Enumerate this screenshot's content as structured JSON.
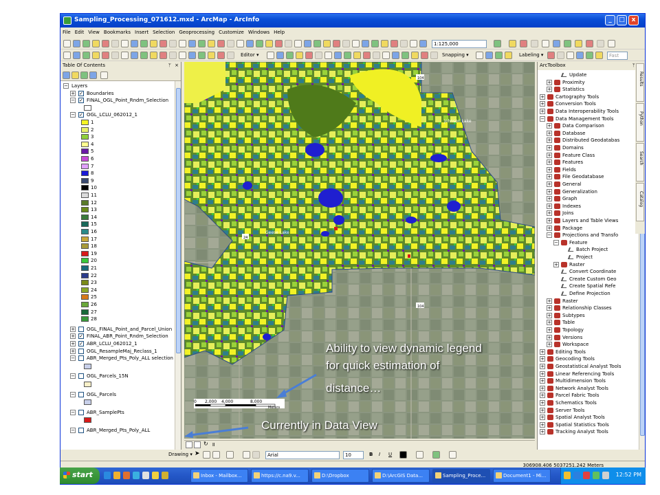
{
  "window": {
    "title": "Sampling_Processing_071612.mxd - ArcMap - ArcInfo",
    "minimize": "_",
    "maximize": "□",
    "close": "x"
  },
  "menu": [
    "File",
    "Edit",
    "View",
    "Bookmarks",
    "Insert",
    "Selection",
    "Geoprocessing",
    "Customize",
    "Windows",
    "Help"
  ],
  "toolbar": {
    "scale": "1:125,000",
    "editor": "Editor ▾",
    "snapping": "Snapping ▾",
    "labeling": "Labeling ▾",
    "fast": "Fast"
  },
  "toc": {
    "title": "Table Of Contents",
    "root": "Layers",
    "layers": [
      {
        "name": "Boundaries",
        "checked": true,
        "expanded": false,
        "indent": 1
      },
      {
        "name": "FINAL_OGL_Point_Rndm_Selection",
        "checked": true,
        "expanded": true,
        "indent": 1
      },
      {
        "name": "OGL_LCLU_062012_1",
        "checked": true,
        "expanded": true,
        "indent": 1
      }
    ],
    "legend_values": [
      "1",
      "2",
      "3",
      "4",
      "5",
      "6",
      "7",
      "8",
      "9",
      "10",
      "11",
      "12",
      "13",
      "14",
      "15",
      "16",
      "17",
      "18",
      "19",
      "20",
      "21",
      "22",
      "23",
      "24",
      "25",
      "26",
      "27",
      "28"
    ],
    "legend_colors": [
      "#f5f524",
      "#e8f06a",
      "#8fd03a",
      "#ffff90",
      "#6a1aa6",
      "#c84ad8",
      "#e0a0ff",
      "#1a1ad8",
      "#3a4a70",
      "#000000",
      "#dcdcdc",
      "#5a7a2a",
      "#6a8a1a",
      "#3a7a3a",
      "#1a6a5a",
      "#2a8a8a",
      "#c8a83a",
      "#a89a3a",
      "#d81a1a",
      "#3ac83a",
      "#1a6a7a",
      "#2a3a8a",
      "#7a8a1a",
      "#8aa82a",
      "#d87a1a",
      "#6aa83a",
      "#1a6a3a",
      "#3a9a3a"
    ],
    "layers_after": [
      {
        "name": "OGL_FINAL_Point_and_Parcel_Union",
        "checked": false,
        "expanded": false
      },
      {
        "name": "FINAL_ABR_Point_Rndm_Selection",
        "checked": true,
        "expanded": false
      },
      {
        "name": "ABR_LCLU_062012_1",
        "checked": true,
        "expanded": false
      },
      {
        "name": "OGL_ResampleMaj_Reclass_1",
        "checked": false,
        "expanded": false
      },
      {
        "name": "ABR_Merged_Pts_Poly_ALL selection",
        "checked": false,
        "expanded": true,
        "swatch": "#c8d0ea"
      },
      {
        "name": "OGL_Parcels_15N",
        "checked": false,
        "expanded": true,
        "swatch": "#f8f0c8"
      },
      {
        "name": "OGL_Parcels",
        "checked": false,
        "expanded": true,
        "swatch": "#c8d0ea"
      },
      {
        "name": "ABR_SamplePts",
        "checked": false,
        "expanded": true,
        "swatch": "#d81a1a"
      },
      {
        "name": "ABR_Merged_Pts_Poly_ALL",
        "checked": false,
        "expanded": true
      }
    ]
  },
  "map": {
    "scalebar_ticks": [
      "0",
      "2,000",
      "4,000",
      "8,000"
    ],
    "scalebar_unit": "Meters",
    "lake_labels": [
      "Johnson Lake",
      "Geese Lake"
    ],
    "road_labels": [
      "104",
      "24",
      "104"
    ]
  },
  "arctoolbox": {
    "title": "ArcToolbox",
    "items": [
      {
        "label": "Update",
        "level": 3,
        "type": "tool"
      },
      {
        "label": "Proximity",
        "level": 2,
        "type": "box"
      },
      {
        "label": "Statistics",
        "level": 2,
        "type": "box"
      },
      {
        "label": "Cartography Tools",
        "level": 1,
        "type": "box"
      },
      {
        "label": "Conversion Tools",
        "level": 1,
        "type": "box"
      },
      {
        "label": "Data Interoperability Tools",
        "level": 1,
        "type": "box"
      },
      {
        "label": "Data Management Tools",
        "level": 1,
        "type": "box",
        "open": true
      },
      {
        "label": "Data Comparison",
        "level": 2,
        "type": "box"
      },
      {
        "label": "Database",
        "level": 2,
        "type": "box"
      },
      {
        "label": "Distributed Geodatabas",
        "level": 2,
        "type": "box"
      },
      {
        "label": "Domains",
        "level": 2,
        "type": "box"
      },
      {
        "label": "Feature Class",
        "level": 2,
        "type": "box"
      },
      {
        "label": "Features",
        "level": 2,
        "type": "box"
      },
      {
        "label": "Fields",
        "level": 2,
        "type": "box"
      },
      {
        "label": "File Geodatabase",
        "level": 2,
        "type": "box"
      },
      {
        "label": "General",
        "level": 2,
        "type": "box"
      },
      {
        "label": "Generalization",
        "level": 2,
        "type": "box"
      },
      {
        "label": "Graph",
        "level": 2,
        "type": "box"
      },
      {
        "label": "Indexes",
        "level": 2,
        "type": "box"
      },
      {
        "label": "Joins",
        "level": 2,
        "type": "box"
      },
      {
        "label": "Layers and Table Views",
        "level": 2,
        "type": "box"
      },
      {
        "label": "Package",
        "level": 2,
        "type": "box"
      },
      {
        "label": "Projections and Transfo",
        "level": 2,
        "type": "box",
        "open": true
      },
      {
        "label": "Feature",
        "level": 3,
        "type": "box",
        "open": true
      },
      {
        "label": "Batch Project",
        "level": 4,
        "type": "tool"
      },
      {
        "label": "Project",
        "level": 4,
        "type": "tool"
      },
      {
        "label": "Raster",
        "level": 3,
        "type": "box"
      },
      {
        "label": "Convert Coordinate",
        "level": 3,
        "type": "tool"
      },
      {
        "label": "Create Custom Geo",
        "level": 3,
        "type": "tool"
      },
      {
        "label": "Create Spatial Refe",
        "level": 3,
        "type": "tool"
      },
      {
        "label": "Define Projection",
        "level": 3,
        "type": "tool"
      },
      {
        "label": "Raster",
        "level": 2,
        "type": "box"
      },
      {
        "label": "Relationship Classes",
        "level": 2,
        "type": "box"
      },
      {
        "label": "Subtypes",
        "level": 2,
        "type": "box"
      },
      {
        "label": "Table",
        "level": 2,
        "type": "box"
      },
      {
        "label": "Topology",
        "level": 2,
        "type": "box"
      },
      {
        "label": "Versions",
        "level": 2,
        "type": "box"
      },
      {
        "label": "Workspace",
        "level": 2,
        "type": "box"
      },
      {
        "label": "Editing Tools",
        "level": 1,
        "type": "box"
      },
      {
        "label": "Geocoding Tools",
        "level": 1,
        "type": "box"
      },
      {
        "label": "Geostatistical Analyst Tools",
        "level": 1,
        "type": "box"
      },
      {
        "label": "Linear Referencing Tools",
        "level": 1,
        "type": "box"
      },
      {
        "label": "Multidimension Tools",
        "level": 1,
        "type": "box"
      },
      {
        "label": "Network Analyst Tools",
        "level": 1,
        "type": "box"
      },
      {
        "label": "Parcel Fabric Tools",
        "level": 1,
        "type": "box"
      },
      {
        "label": "Schematics Tools",
        "level": 1,
        "type": "box"
      },
      {
        "label": "Server Tools",
        "level": 1,
        "type": "box"
      },
      {
        "label": "Spatial Analyst Tools",
        "level": 1,
        "type": "box"
      },
      {
        "label": "Spatial Statistics Tools",
        "level": 1,
        "type": "box"
      },
      {
        "label": "Tracking Analyst Tools",
        "level": 1,
        "type": "box"
      }
    ]
  },
  "side_tabs": [
    "Results",
    "Python",
    "Search",
    "Catalog"
  ],
  "drawing": {
    "label": "Drawing ▾",
    "font": "Arial",
    "size": "10",
    "bold": "B",
    "italic": "I",
    "underline": "U"
  },
  "status": {
    "coordinates": "306908.406  5037251.242 Meters"
  },
  "taskbar": {
    "start": "start",
    "tasks": [
      "Inbox - Mailbox...",
      "https://c.na9.v...",
      "D:\\Dropbox",
      "D:\\ArcGIS Data...",
      "Sampling_Proce...",
      "Document1 - Mi..."
    ],
    "active_index": 4,
    "clock": "12:52 PM"
  },
  "annotations": {
    "legend_note_line1": "Ability to view dynamic legend",
    "legend_note_line2": "for quick estimation of",
    "legend_note_line3": "distance…",
    "data_view_note": "Currently in Data View"
  }
}
